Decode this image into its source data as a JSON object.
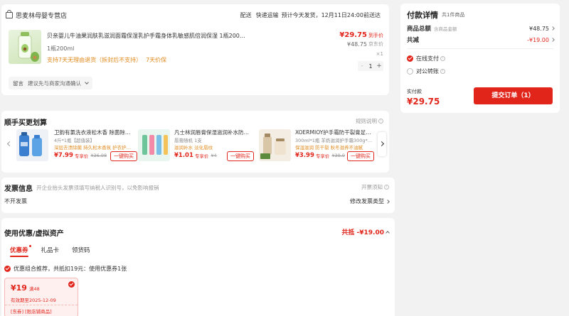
{
  "store": {
    "name": "思麦林母婴专营店",
    "shipping_label": "配送",
    "shipping_method": "快递运输",
    "eta": "预计今天发货，12月11日24:00前送达"
  },
  "product": {
    "title": "贝亲婴儿牛油果润肤乳滋润面霜保湿乳护手霜身体乳敏感肌倍润保湿 1瓶200ml",
    "spec": "1瓶200ml",
    "return_policy": "支持7天无理由退货（拆封后不支持）",
    "guarantee": "7天价保",
    "price": "¥29.75",
    "price_tag": "到手价",
    "original_price": "¥48.75",
    "original_tag": "京东价",
    "qty_label": "×1",
    "qty_value": "1",
    "minus": "-",
    "plus": "+"
  },
  "message": {
    "label": "留言",
    "placeholder": "建议先与商家沟通确认"
  },
  "addon": {
    "title": "顺手买更划算",
    "rules": "规则说明",
    "items": [
      {
        "title": "卫韵有氯洗衣液松木香 除菌除螨除",
        "spec": "4斤*1瓶【超值装】",
        "tag": "深层去渍除菌 持久松木香氛 护衣护色无",
        "price": "¥7.99",
        "price_tag": "专享价",
        "original": "¥36.98",
        "btn": "一键购买"
      },
      {
        "title": "凡士林润唇膏保湿滋润补水防干裂",
        "spec": "唇膏随机 1支",
        "tag": "滋润补水 淡化唇纹",
        "price": "¥1.01",
        "price_tag": "专享价",
        "original": "¥4",
        "btn": "一键购买"
      },
      {
        "title": "XOERMIOY护手霜防干裂膏足裂秀",
        "spec": "300ml*1瓶 羊奶滋润护手霜300g*1瓶",
        "tag": "保湿滋润 防干裂 秋冬滋养不油腻",
        "price": "¥3.99",
        "price_tag": "专享价",
        "original": "¥39.9",
        "btn": "一键购买"
      }
    ]
  },
  "invoice": {
    "title": "发票信息",
    "desc": "开企业抬头发票须填写纳税人识别号，以免影响报销",
    "notice": "开票须知",
    "current": "不开发票",
    "change": "修改发票类型"
  },
  "coupons": {
    "title": "使用优惠/虚拟资产",
    "total": "共抵 -¥19.00",
    "tabs": [
      "优惠券",
      "礼品卡",
      "领货码"
    ],
    "recommend": "优惠组合推荐，共抵扣19元：使用优惠券1张",
    "coupon": {
      "amount": "¥19",
      "condition": "满48",
      "validity": "有效期至2025-12-09",
      "scope": "[东券] [限店铺商品]"
    }
  },
  "payment": {
    "title": "付款详情",
    "count": "共1件商品",
    "goods_label": "商品总额",
    "goods_sub": "含商品金额",
    "goods_value": "¥48.75",
    "discount_label": "共减",
    "discount_value": "-¥19.00",
    "methods": [
      "在线支付",
      "对公转账"
    ],
    "actual_label": "实付款",
    "actual_value": "¥29.75",
    "submit": "提交订单（1）"
  },
  "colors": {
    "accent": "#e1251b",
    "muted": "#999999",
    "background": "#f2f2f2"
  }
}
